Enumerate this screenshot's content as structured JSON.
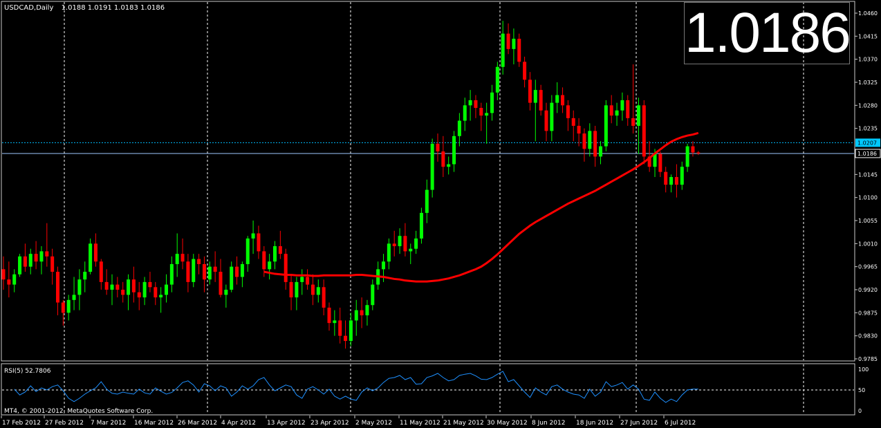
{
  "header": {
    "symbol_label": "USDCAD,Daily",
    "ohlc": "1.0188 1.0191 1.0183 1.0186"
  },
  "big_price": "1.0186",
  "copyright": "MT4, © 2001-2012, MetaQuotes Software Corp.",
  "colors": {
    "background": "#000000",
    "bull": "#00ff00",
    "bear": "#ff0000",
    "ma": "#ff0000",
    "rsi": "#1e90ff",
    "grid": "#ffffff",
    "ask_line": "#00bfff",
    "bid_line": "#9ec8ff"
  },
  "chart_data": [
    {
      "type": "candlestick",
      "title": "USDCAD,Daily",
      "price_ticks": [
        "1.0460",
        "1.0415",
        "1.0370",
        "1.0325",
        "1.0280",
        "1.0235",
        "1.0190",
        "1.0145",
        "1.0100",
        "1.0055",
        "1.0010",
        "0.9965",
        "0.9920",
        "0.9875",
        "0.9830",
        "0.9785"
      ],
      "ylim": [
        0.977,
        1.047
      ],
      "date_labels": [
        "17 Feb 2012",
        "27 Feb 2012",
        "7 Mar 2012",
        "16 Mar 2012",
        "26 Mar 2012",
        "4 Apr 2012",
        "13 Apr 2012",
        "23 Apr 2012",
        "2 May 2012",
        "11 May 2012",
        "21 May 2012",
        "30 May 2012",
        "8 Jun 2012",
        "18 Jun 2012",
        "27 Jun 2012",
        "6 Jul 2012"
      ],
      "ask_label": "1.0207",
      "bid_label": "1.0186",
      "ask_price": 1.0207,
      "bid_price": 1.0186,
      "grid": true,
      "candles": [
        [
          0.996,
          0.9985,
          0.992,
          0.994
        ],
        [
          0.994,
          0.9975,
          0.9905,
          0.993
        ],
        [
          0.993,
          0.996,
          0.9915,
          0.995
        ],
        [
          0.995,
          0.999,
          0.9945,
          0.9985
        ],
        [
          0.9985,
          1.001,
          0.9955,
          0.9965
        ],
        [
          0.9965,
          1.0,
          0.995,
          0.999
        ],
        [
          0.999,
          1.0015,
          0.996,
          0.9975
        ],
        [
          0.9975,
          1.0005,
          0.995,
          0.9995
        ],
        [
          0.9995,
          1.005,
          0.9965,
          0.9985
        ],
        [
          0.9985,
          1.0,
          0.993,
          0.9955
        ],
        [
          0.9955,
          0.9965,
          0.987,
          0.9895
        ],
        [
          0.9895,
          0.99,
          0.985,
          0.9875
        ],
        [
          0.9875,
          0.991,
          0.986,
          0.99
        ],
        [
          0.99,
          0.9945,
          0.988,
          0.991
        ],
        [
          0.991,
          0.996,
          0.988,
          0.994
        ],
        [
          0.994,
          0.9975,
          0.9915,
          0.9955
        ],
        [
          0.9955,
          1.002,
          0.995,
          1.001
        ],
        [
          1.001,
          1.003,
          0.9965,
          0.9975
        ],
        [
          0.9975,
          0.998,
          0.992,
          0.9935
        ],
        [
          0.9935,
          0.996,
          0.991,
          0.992
        ],
        [
          0.992,
          0.995,
          0.989,
          0.993
        ],
        [
          0.993,
          0.9945,
          0.9905,
          0.992
        ],
        [
          0.992,
          0.9935,
          0.9895,
          0.991
        ],
        [
          0.991,
          0.995,
          0.988,
          0.994
        ],
        [
          0.994,
          0.9965,
          0.9895,
          0.9915
        ],
        [
          0.9915,
          0.9935,
          0.988,
          0.9905
        ],
        [
          0.9905,
          0.9945,
          0.989,
          0.9935
        ],
        [
          0.9935,
          0.9955,
          0.9915,
          0.9925
        ],
        [
          0.9925,
          0.9935,
          0.989,
          0.9905
        ],
        [
          0.9905,
          0.9925,
          0.9875,
          0.991
        ],
        [
          0.991,
          0.995,
          0.9895,
          0.993
        ],
        [
          0.993,
          0.9985,
          0.9915,
          0.997
        ],
        [
          0.997,
          1.003,
          0.9945,
          0.999
        ],
        [
          0.999,
          1.002,
          0.996,
          0.9975
        ],
        [
          0.9975,
          0.999,
          0.9915,
          0.9935
        ],
        [
          0.9935,
          0.999,
          0.9925,
          0.998
        ],
        [
          0.998,
          0.999,
          0.995,
          0.997
        ],
        [
          0.997,
          0.9985,
          0.9915,
          0.994
        ],
        [
          0.994,
          0.9975,
          0.993,
          0.9965
        ],
        [
          0.9965,
          0.9995,
          0.9935,
          0.9955
        ],
        [
          0.9955,
          0.998,
          0.9905,
          0.991
        ],
        [
          0.991,
          0.993,
          0.9885,
          0.992
        ],
        [
          0.992,
          0.9975,
          0.9915,
          0.9965
        ],
        [
          0.9965,
          0.9985,
          0.993,
          0.9945
        ],
        [
          0.9945,
          0.9975,
          0.9925,
          0.997
        ],
        [
          0.997,
          1.0025,
          0.9955,
          1.002
        ],
        [
          1.002,
          1.0055,
          0.999,
          1.003
        ],
        [
          1.003,
          1.0045,
          0.998,
          0.9995
        ],
        [
          0.9995,
          1.0005,
          0.9945,
          0.996
        ],
        [
          0.996,
          0.999,
          0.994,
          0.9975
        ],
        [
          0.9975,
          1.0015,
          0.996,
          1.0005
        ],
        [
          1.0005,
          1.0035,
          0.998,
          0.999
        ],
        [
          0.999,
          1.0,
          0.992,
          0.9935
        ],
        [
          0.9935,
          0.995,
          0.988,
          0.9905
        ],
        [
          0.9905,
          0.9945,
          0.988,
          0.9935
        ],
        [
          0.9935,
          0.996,
          0.991,
          0.9945
        ],
        [
          0.9945,
          0.996,
          0.992,
          0.993
        ],
        [
          0.993,
          0.995,
          0.989,
          0.991
        ],
        [
          0.991,
          0.994,
          0.9895,
          0.9925
        ],
        [
          0.9925,
          0.994,
          0.987,
          0.9885
        ],
        [
          0.9885,
          0.9895,
          0.984,
          0.9855
        ],
        [
          0.9855,
          0.988,
          0.983,
          0.986
        ],
        [
          0.986,
          0.9885,
          0.9815,
          0.983
        ],
        [
          0.983,
          0.986,
          0.9805,
          0.982
        ],
        [
          0.982,
          0.9875,
          0.981,
          0.986
        ],
        [
          0.986,
          0.99,
          0.983,
          0.988
        ],
        [
          0.988,
          0.9905,
          0.9845,
          0.987
        ],
        [
          0.987,
          0.99,
          0.985,
          0.989
        ],
        [
          0.989,
          0.994,
          0.988,
          0.993
        ],
        [
          0.993,
          0.9975,
          0.992,
          0.996
        ],
        [
          0.996,
          0.999,
          0.9935,
          0.9975
        ],
        [
          0.9975,
          1.002,
          0.996,
          1.001
        ],
        [
          1.001,
          1.0035,
          0.9985,
          1.0005
        ],
        [
          1.0005,
          1.004,
          0.999,
          1.0025
        ],
        [
          1.0025,
          1.005,
          0.9985,
          0.9995
        ],
        [
          0.9995,
          1.001,
          0.997,
          1.0
        ],
        [
          1.0,
          1.0035,
          0.999,
          1.002
        ],
        [
          1.002,
          1.008,
          1.001,
          1.007
        ],
        [
          1.007,
          1.0135,
          1.005,
          1.0115
        ],
        [
          1.0115,
          1.0215,
          1.01,
          1.0205
        ],
        [
          1.0205,
          1.0225,
          1.017,
          1.019
        ],
        [
          1.019,
          1.022,
          1.014,
          1.016
        ],
        [
          1.016,
          1.018,
          1.0145,
          1.0165
        ],
        [
          1.0165,
          1.023,
          1.015,
          1.022
        ],
        [
          1.022,
          1.0265,
          1.02,
          1.025
        ],
        [
          1.025,
          1.0295,
          1.023,
          1.028
        ],
        [
          1.028,
          1.031,
          1.025,
          1.029
        ],
        [
          1.029,
          1.03,
          1.0255,
          1.0275
        ],
        [
          1.0275,
          1.0285,
          1.023,
          1.026
        ],
        [
          1.026,
          1.0285,
          1.0205,
          1.0265
        ],
        [
          1.0265,
          1.032,
          1.025,
          1.0305
        ],
        [
          1.0305,
          1.0365,
          1.029,
          1.0355
        ],
        [
          1.0355,
          1.0445,
          1.034,
          1.042
        ],
        [
          1.042,
          1.044,
          1.038,
          1.039
        ],
        [
          1.039,
          1.043,
          1.036,
          1.041
        ],
        [
          1.041,
          1.042,
          1.0355,
          1.0365
        ],
        [
          1.0365,
          1.0375,
          1.0315,
          1.033
        ],
        [
          1.033,
          1.0345,
          1.027,
          1.0285
        ],
        [
          1.0285,
          1.033,
          1.021,
          1.031
        ],
        [
          1.031,
          1.032,
          1.026,
          1.027
        ],
        [
          1.027,
          1.0285,
          1.021,
          1.023
        ],
        [
          1.023,
          1.03,
          1.021,
          1.0285
        ],
        [
          1.0285,
          1.0325,
          1.0265,
          1.03
        ],
        [
          1.03,
          1.0315,
          1.0265,
          1.028
        ],
        [
          1.028,
          1.029,
          1.023,
          1.0255
        ],
        [
          1.0255,
          1.027,
          1.021,
          1.024
        ],
        [
          1.024,
          1.0255,
          1.02,
          1.0225
        ],
        [
          1.0225,
          1.0235,
          1.017,
          1.0195
        ],
        [
          1.0195,
          1.0245,
          1.018,
          1.023
        ],
        [
          1.023,
          1.024,
          1.016,
          1.018
        ],
        [
          1.018,
          1.021,
          1.0165,
          1.02
        ],
        [
          1.02,
          1.029,
          1.019,
          1.028
        ],
        [
          1.028,
          1.03,
          1.0245,
          1.026
        ],
        [
          1.026,
          1.0285,
          1.024,
          1.027
        ],
        [
          1.027,
          1.0305,
          1.025,
          1.029
        ],
        [
          1.029,
          1.03,
          1.024,
          1.0255
        ],
        [
          1.0255,
          1.036,
          1.0225,
          1.024
        ],
        [
          1.024,
          1.0295,
          1.0185,
          1.028
        ],
        [
          1.028,
          1.029,
          1.0165,
          1.018
        ],
        [
          1.018,
          1.021,
          1.015,
          1.016
        ],
        [
          1.016,
          1.0195,
          1.014,
          1.0185
        ],
        [
          1.0185,
          1.019,
          1.014,
          1.015
        ],
        [
          1.015,
          1.016,
          1.011,
          1.0125
        ],
        [
          1.0125,
          1.0145,
          1.011,
          1.014
        ],
        [
          1.014,
          1.0165,
          1.01,
          1.0125
        ],
        [
          1.0125,
          1.017,
          1.0115,
          1.016
        ],
        [
          1.016,
          1.0205,
          1.015,
          1.02
        ],
        [
          1.02,
          1.021,
          1.018,
          1.0188
        ],
        [
          1.0188,
          1.0191,
          1.0183,
          1.0186
        ]
      ],
      "ma": [
        0.9955,
        0.9953,
        0.9951,
        0.995,
        0.9949,
        0.9949,
        0.9948,
        0.9948,
        0.9948,
        0.9947,
        0.9947,
        0.9948,
        0.9948,
        0.9948,
        0.9948,
        0.9948,
        0.9948,
        0.9949,
        0.9949,
        0.9948,
        0.9947,
        0.9946,
        0.9945,
        0.9943,
        0.9941,
        0.994,
        0.9938,
        0.9937,
        0.9936,
        0.9936,
        0.9936,
        0.9937,
        0.9938,
        0.994,
        0.9942,
        0.9945,
        0.9948,
        0.9952,
        0.9956,
        0.996,
        0.9965,
        0.9972,
        0.998,
        0.9989,
        0.9999,
        1.0009,
        1.0019,
        1.0029,
        1.0037,
        1.0045,
        1.0052,
        1.0058,
        1.0064,
        1.007,
        1.0076,
        1.0082,
        1.0088,
        1.0093,
        1.0098,
        1.0103,
        1.0108,
        1.0113,
        1.0119,
        1.0125,
        1.0131,
        1.0137,
        1.0143,
        1.0149,
        1.0155,
        1.0162,
        1.0169,
        1.0177,
        1.0186,
        1.0194,
        1.0202,
        1.0209,
        1.0214,
        1.0218,
        1.0221,
        1.0223,
        1.0226
      ],
      "rsi_label": "RSI(5) 52.7806",
      "rsi_levels": [
        "100",
        "50",
        "0"
      ],
      "rsi": [
        52,
        38,
        45,
        60,
        46,
        55,
        50,
        58,
        62,
        48,
        30,
        22,
        30,
        40,
        48,
        55,
        70,
        52,
        42,
        40,
        45,
        42,
        40,
        52,
        43,
        40,
        55,
        47,
        40,
        44,
        55,
        68,
        72,
        62,
        45,
        65,
        60,
        48,
        60,
        55,
        35,
        45,
        60,
        52,
        60,
        75,
        80,
        62,
        48,
        55,
        62,
        58,
        38,
        30,
        52,
        58,
        50,
        40,
        52,
        35,
        28,
        35,
        28,
        25,
        45,
        55,
        48,
        55,
        68,
        78,
        80,
        85,
        75,
        80,
        64,
        65,
        80,
        84,
        90,
        80,
        72,
        75,
        85,
        88,
        90,
        84,
        76,
        75,
        80,
        88,
        95,
        70,
        75,
        60,
        45,
        32,
        55,
        45,
        38,
        58,
        62,
        52,
        45,
        40,
        38,
        30,
        52,
        35,
        45,
        70,
        58,
        62,
        68,
        52,
        62,
        52,
        28,
        25,
        45,
        30,
        20,
        28,
        22,
        38,
        50,
        52,
        52
      ]
    }
  ]
}
